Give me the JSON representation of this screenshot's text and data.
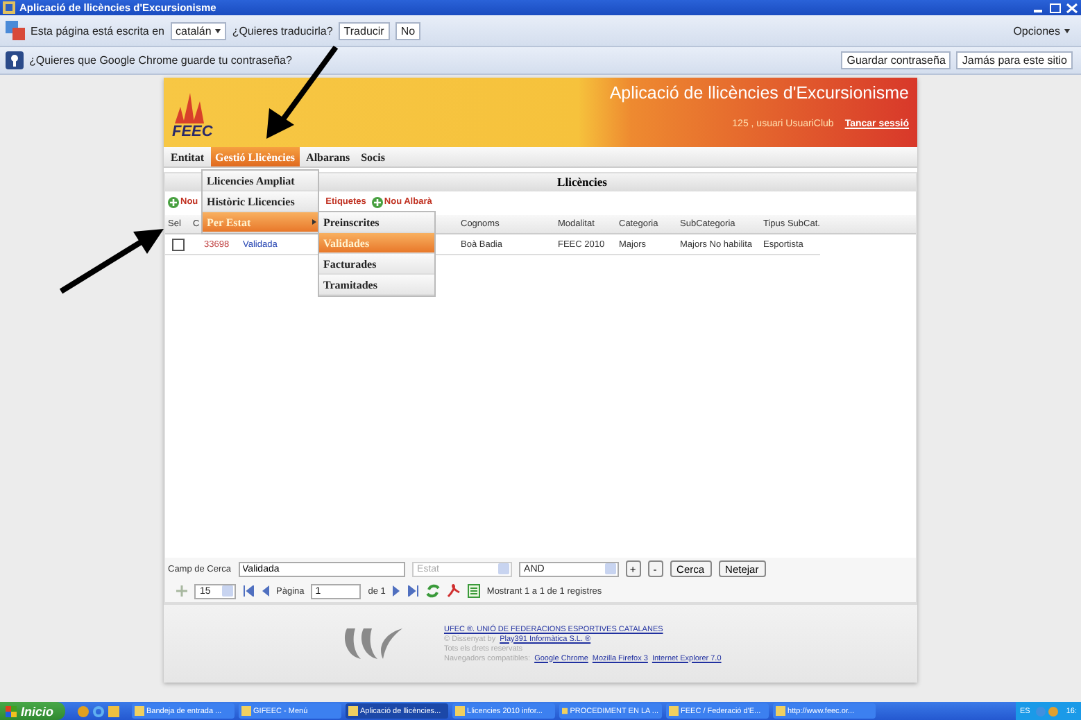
{
  "window": {
    "title": "Aplicació de llicències d'Excursionisme"
  },
  "translate_bar": {
    "text": "Esta página está escrita en",
    "language": "catalán",
    "question": "¿Quieres traducirla?",
    "buttons": [
      "Traducir",
      "No"
    ],
    "options": "Opciones"
  },
  "password_bar": {
    "text": "¿Quieres que Google Chrome guarde tu contraseña?",
    "buttons": [
      "Guardar contraseña",
      "Jamás para este sitio"
    ]
  },
  "header": {
    "logo": "FEEC",
    "title": "Aplicació de llicències d'Excursionisme",
    "user": "125 , usuari UsuariClub",
    "logout": "Tancar sessió"
  },
  "menu": [
    {
      "label": "Entitat",
      "selected": false
    },
    {
      "label": "Gestió Llicències",
      "selected": true
    },
    {
      "label": "Albarans",
      "selected": false
    },
    {
      "label": "Socis",
      "selected": false
    }
  ],
  "dropdown": [
    {
      "label": "Llicencies Ampliat",
      "selected": false
    },
    {
      "label": "Històric Llicencies",
      "selected": false
    },
    {
      "label": "Per Estat",
      "selected": true,
      "children": [
        {
          "label": "Preinscrites",
          "selected": false
        },
        {
          "label": "Validades",
          "selected": true
        },
        {
          "label": "Facturades",
          "selected": false
        },
        {
          "label": "Tramitades",
          "selected": false
        }
      ]
    }
  ],
  "panel_title": "Llicències",
  "toolbar": [
    {
      "label": "Nou",
      "kind": "add"
    },
    {
      "label": "Etiquetes",
      "kind": "plain"
    },
    {
      "label": "Nou Albarà",
      "kind": "add"
    }
  ],
  "table": {
    "columns": [
      "Sel",
      "C",
      "Cognoms",
      "Modalitat",
      "Categoria",
      "SubCategoria",
      "Tipus SubCat."
    ],
    "rows": [
      {
        "checked": false,
        "cells": [
          "33698",
          "Validada",
          "Boà Badia",
          "FEEC 2010",
          "Majors",
          "Majors No habilita",
          "Esportista"
        ]
      }
    ]
  },
  "search": {
    "label": "Camp de Cerca",
    "value": "Validada",
    "field": "Estat",
    "operator": "AND",
    "buttons": [
      "+",
      "-",
      "Cerca",
      "Netejar"
    ]
  },
  "pager": {
    "page_size": "15",
    "page_label": "Pàgina",
    "page": "1",
    "of": "de 1",
    "info": "Mostrant 1 a 1 de 1 registres"
  },
  "footer": [
    {
      "kind": "link",
      "text": "UFEC ®. UNIÓ DE FEDERACIONS ESPORTIVES CATALANES"
    },
    {
      "kind": "mixed",
      "text": "© Dissenyat by",
      "links": [
        "Play391 Informàtica S.L. ®"
      ]
    },
    {
      "kind": "plain",
      "text": "Tots els drets reservats"
    },
    {
      "kind": "mixed",
      "text": "Navegadors compatibles:",
      "links": [
        "Google Chrome",
        "Mozilla Firefox 3",
        "Internet Explorer 7.0"
      ]
    }
  ],
  "taskbar": {
    "start": "Inicio",
    "tasks": [
      {
        "label": "Bandeja de entrada ...",
        "selected": false
      },
      {
        "label": "GIFEEC - Menú",
        "selected": false
      },
      {
        "label": "Aplicació de llicències...",
        "selected": true
      },
      {
        "label": "Llicencies 2010 infor...",
        "selected": false
      },
      {
        "label": "PROCEDIMENT EN LA ...",
        "selected": false
      },
      {
        "label": "FEEC / Federació d'E...",
        "selected": false
      },
      {
        "label": "http://www.feec.or...",
        "selected": false
      }
    ],
    "language": "ES",
    "clock": "16:"
  }
}
